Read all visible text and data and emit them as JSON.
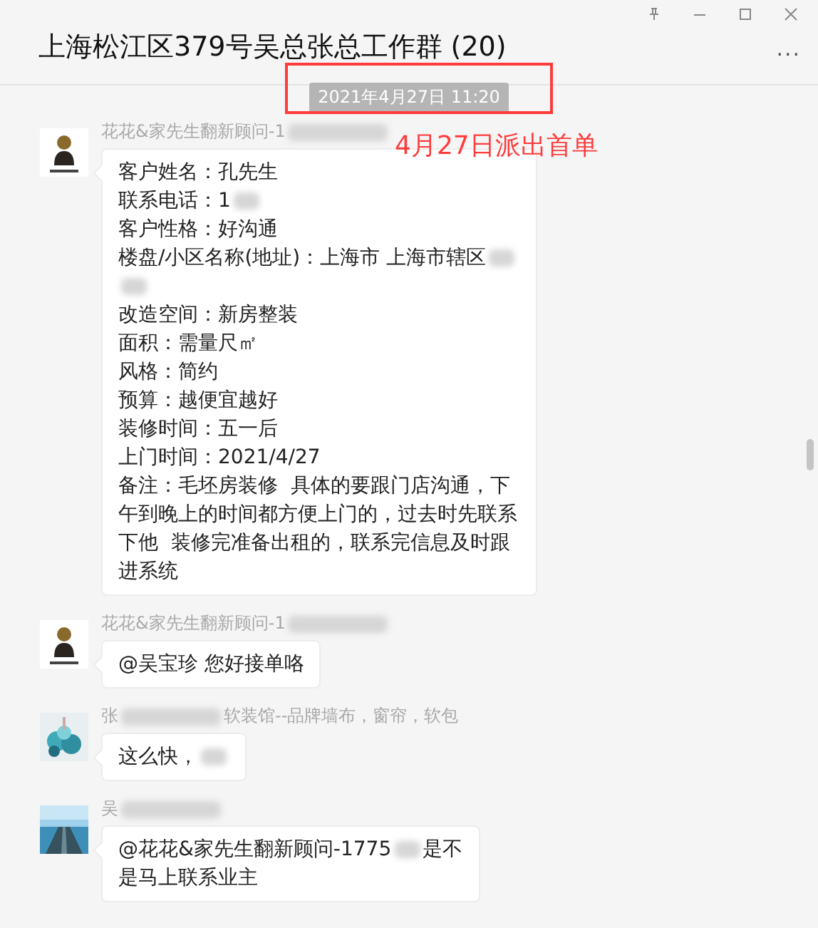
{
  "window": {
    "title": "上海松江区379号吴总张总工作群 (20)",
    "more_menu": "..."
  },
  "timestamp": "2021年4月27日 11:20",
  "annotation": {
    "text": "4月27日派出首单",
    "color": "#ff3b3b"
  },
  "messages": [
    {
      "avatar": {
        "kind": "figure"
      },
      "sender": [
        {
          "kind": "text",
          "text": "花花&家先生翻新顾问-1"
        },
        {
          "kind": "blur"
        }
      ],
      "lines": [
        [
          {
            "kind": "text",
            "text": "客户姓名：孔先生"
          }
        ],
        [
          {
            "kind": "text",
            "text": "联系电话：1"
          },
          {
            "kind": "blur"
          }
        ],
        [
          {
            "kind": "text",
            "text": "客户性格：好沟通"
          }
        ],
        [
          {
            "kind": "text",
            "text": "楼盘/小区名称(地址)：上海市 上海市辖区"
          },
          {
            "kind": "blur"
          }
        ],
        [
          {
            "kind": "blur"
          }
        ],
        [
          {
            "kind": "text",
            "text": "改造空间：新房整装"
          }
        ],
        [
          {
            "kind": "text",
            "text": "面积：需量尺㎡"
          }
        ],
        [
          {
            "kind": "text",
            "text": "风格：简约"
          }
        ],
        [
          {
            "kind": "text",
            "text": "预算：越便宜越好"
          }
        ],
        [
          {
            "kind": "text",
            "text": "装修时间：五一后"
          }
        ],
        [
          {
            "kind": "text",
            "text": "上门时间：2021/4/27"
          }
        ],
        [
          {
            "kind": "text",
            "text": "备注：毛坯房装修  具体的要跟门店沟通，下午到晚上的时间都方便上门的，过去时先联系下他  装修完准备出租的，联系完信息及时跟进系统"
          }
        ]
      ]
    },
    {
      "avatar": {
        "kind": "figure"
      },
      "sender": [
        {
          "kind": "text",
          "text": "花花&家先生翻新顾问-1"
        },
        {
          "kind": "blur"
        }
      ],
      "lines": [
        [
          {
            "kind": "text",
            "text": "@吴宝珍 您好接单咯"
          }
        ]
      ]
    },
    {
      "avatar": {
        "kind": "picture"
      },
      "sender": [
        {
          "kind": "text",
          "text": "张"
        },
        {
          "kind": "blur"
        },
        {
          "kind": "text",
          "text": "软装馆--品牌墙布，窗帘，软包"
        }
      ],
      "lines": [
        [
          {
            "kind": "text",
            "text": "这么快，"
          },
          {
            "kind": "blur"
          }
        ]
      ]
    },
    {
      "avatar": {
        "kind": "landscape"
      },
      "sender": [
        {
          "kind": "text",
          "text": "吴"
        },
        {
          "kind": "blur"
        }
      ],
      "lines": [
        [
          {
            "kind": "text",
            "text": "@花花&家先生翻新顾问-1775"
          },
          {
            "kind": "blur"
          },
          {
            "kind": "text",
            "text": "是不"
          }
        ],
        [
          {
            "kind": "text",
            "text": "是马上联系业主"
          }
        ]
      ]
    }
  ]
}
